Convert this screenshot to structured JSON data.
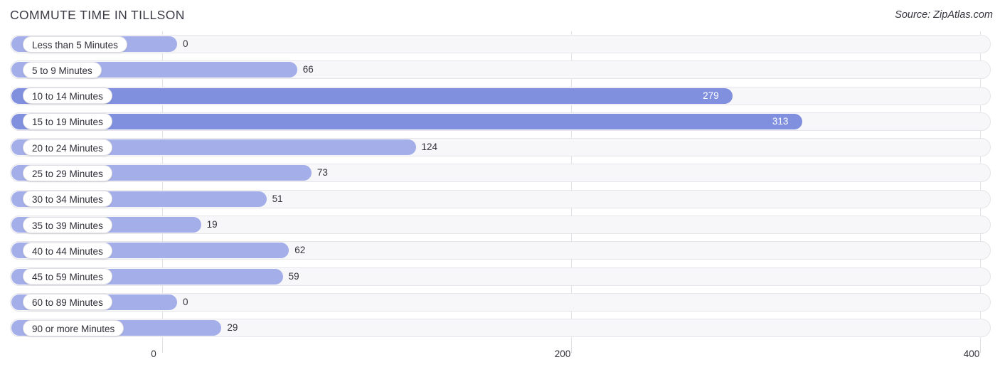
{
  "header": {
    "title": "COMMUTE TIME IN TILLSON",
    "source": "Source: ZipAtlas.com"
  },
  "colors": {
    "bar": "#a4aee9",
    "bar_strong": "#8090df",
    "track": "#f7f7f9",
    "gridline": "#e2e2e6",
    "text": "#33333c"
  },
  "chart_data": {
    "type": "bar",
    "orientation": "horizontal",
    "title": "COMMUTE TIME IN TILLSON",
    "xlabel": "",
    "ylabel": "",
    "xlim": [
      0,
      400
    ],
    "ticks": [
      "0",
      "200",
      "400"
    ],
    "tick_values": [
      0,
      200,
      400
    ],
    "grid": true,
    "legend": "none",
    "categories": [
      "Less than 5 Minutes",
      "5 to 9 Minutes",
      "10 to 14 Minutes",
      "15 to 19 Minutes",
      "20 to 24 Minutes",
      "25 to 29 Minutes",
      "30 to 34 Minutes",
      "35 to 39 Minutes",
      "40 to 44 Minutes",
      "45 to 59 Minutes",
      "60 to 89 Minutes",
      "90 or more Minutes"
    ],
    "values": [
      0,
      66,
      279,
      313,
      124,
      73,
      51,
      19,
      62,
      59,
      0,
      29
    ],
    "value_labels": [
      "0",
      "66",
      "279",
      "313",
      "124",
      "73",
      "51",
      "19",
      "62",
      "59",
      "0",
      "29"
    ]
  }
}
